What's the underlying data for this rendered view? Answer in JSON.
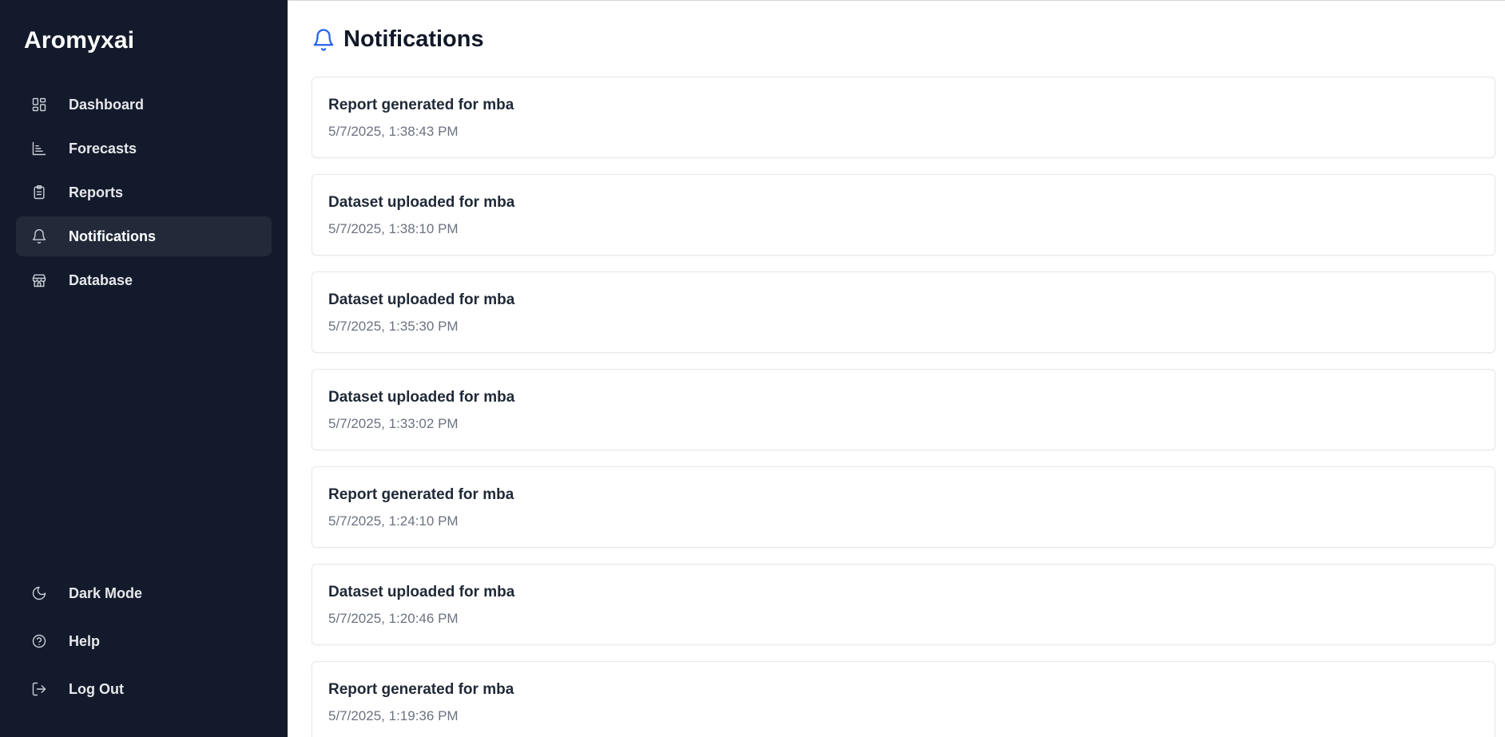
{
  "sidebar": {
    "brand": "Aromyxai",
    "items": [
      {
        "label": "Dashboard",
        "icon": "dashboard-icon"
      },
      {
        "label": "Forecasts",
        "icon": "chart-icon"
      },
      {
        "label": "Reports",
        "icon": "clipboard-icon"
      },
      {
        "label": "Notifications",
        "icon": "bell-icon",
        "active": true
      },
      {
        "label": "Database",
        "icon": "store-icon"
      }
    ],
    "bottom_items": [
      {
        "label": "Dark Mode",
        "icon": "moon-icon"
      },
      {
        "label": "Help",
        "icon": "help-circle-icon"
      },
      {
        "label": "Log Out",
        "icon": "logout-icon"
      }
    ]
  },
  "main": {
    "title": "Notifications",
    "notifications": [
      {
        "title": "Report generated for mba",
        "time": "5/7/2025, 1:38:43 PM"
      },
      {
        "title": "Dataset uploaded for mba",
        "time": "5/7/2025, 1:38:10 PM"
      },
      {
        "title": "Dataset uploaded for mba",
        "time": "5/7/2025, 1:35:30 PM"
      },
      {
        "title": "Dataset uploaded for mba",
        "time": "5/7/2025, 1:33:02 PM"
      },
      {
        "title": "Report generated for mba",
        "time": "5/7/2025, 1:24:10 PM"
      },
      {
        "title": "Dataset uploaded for mba",
        "time": "5/7/2025, 1:20:46 PM"
      },
      {
        "title": "Report generated for mba",
        "time": "5/7/2025, 1:19:36 PM"
      }
    ]
  },
  "colors": {
    "sidebar_bg": "#131a2b",
    "active_item_bg": "#222a3a",
    "accent": "#2563eb"
  }
}
